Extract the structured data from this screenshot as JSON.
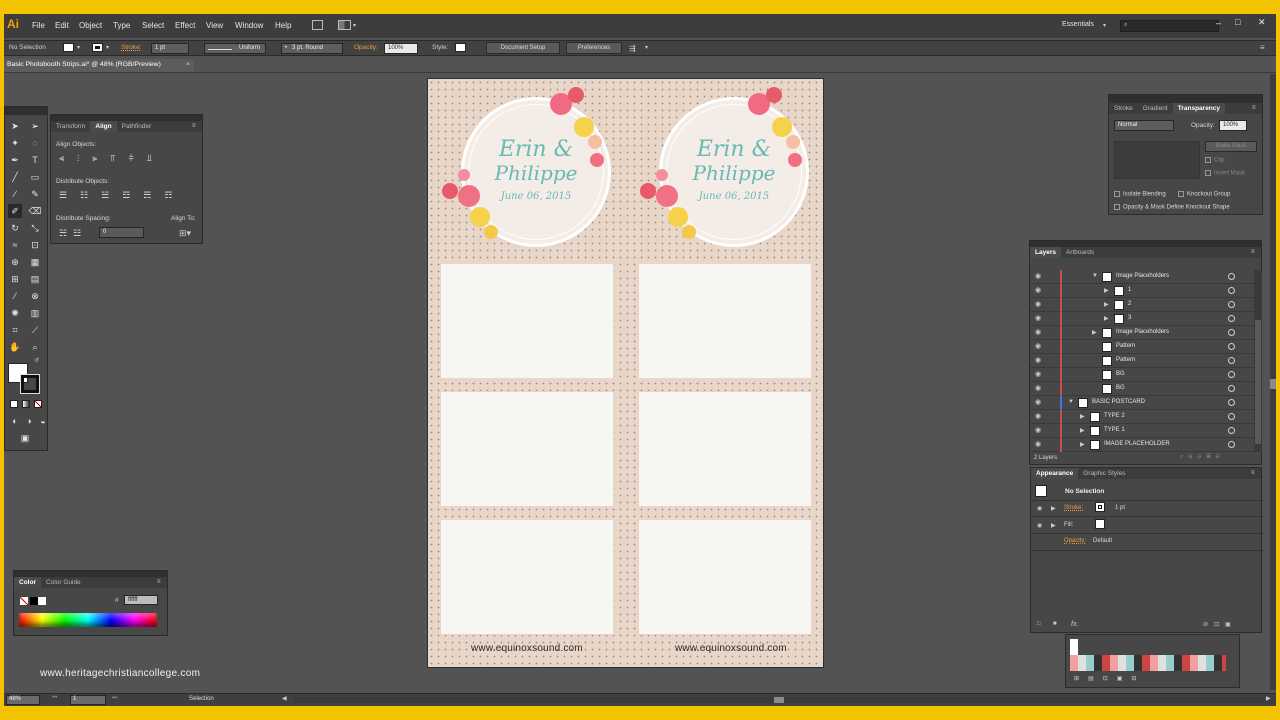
{
  "app": {
    "logo": "Ai",
    "menu": [
      "File",
      "Edit",
      "Object",
      "Type",
      "Select",
      "Effect",
      "View",
      "Window",
      "Help"
    ],
    "workspace": "Essentials",
    "search_placeholder": "",
    "win_controls": {
      "minimize": "–",
      "maximize": "□",
      "close": "✕"
    }
  },
  "control_bar": {
    "selection_label": "No Selection",
    "stroke_label": "Stroke:",
    "stroke_value": "1 pt",
    "profile_value": "Uniform",
    "brush_value": "3 pt. Round",
    "opacity_label": "Opacity:",
    "opacity_value": "100%",
    "style_label": "Style:",
    "document_setup": "Document Setup",
    "preferences": "Preferences"
  },
  "document_tab": {
    "title": "Basic Photobooth Strips.ai* @ 48% (RGB/Preview)",
    "close": "×"
  },
  "align_panel": {
    "tabs": [
      "Transform",
      "Align",
      "Pathfinder"
    ],
    "active_tab": "Align",
    "align_objects": "Align Objects:",
    "distribute_objects": "Distribute Objects:",
    "distribute_spacing": "Distribute Spacing:",
    "align_to": "Align To:",
    "spacing_value": "0"
  },
  "transparency_panel": {
    "tabs": [
      "Stroke",
      "Gradient",
      "Transparency"
    ],
    "active_tab": "Transparency",
    "blend_mode": "Normal",
    "opacity_label": "Opacity:",
    "opacity_value": "100%",
    "make_mask": "Make Mask",
    "clip": "Clip",
    "invert_mask": "Invert Mask",
    "isolate_blending": "Isolate Blending",
    "knockout_group": "Knockout Group",
    "opacity_mask": "Opacity & Mask Define Knockout Shape"
  },
  "layers_panel": {
    "tabs": [
      "Layers",
      "Artboards"
    ],
    "active_tab": "Layers",
    "rows": [
      {
        "name": "Image Placeholders",
        "indent": 2,
        "expand": "open"
      },
      {
        "name": "1",
        "indent": 3,
        "expand": "closed"
      },
      {
        "name": "2",
        "indent": 3,
        "expand": "closed"
      },
      {
        "name": "3",
        "indent": 3,
        "expand": "closed"
      },
      {
        "name": "Image Placeholders",
        "indent": 2,
        "expand": "closed"
      },
      {
        "name": "Pattern",
        "indent": 2,
        "expand": "none"
      },
      {
        "name": "Pattern",
        "indent": 2,
        "expand": "none"
      },
      {
        "name": "BG",
        "indent": 2,
        "expand": "none"
      },
      {
        "name": "BG",
        "indent": 2,
        "expand": "none"
      },
      {
        "name": "BASIC POSTCARD",
        "indent": 0,
        "expand": "open"
      },
      {
        "name": "TYPE 2",
        "indent": 1,
        "expand": "closed"
      },
      {
        "name": "TYPE 1",
        "indent": 1,
        "expand": "closed"
      },
      {
        "name": "IMAGE PLACEHOLDER",
        "indent": 1,
        "expand": "closed"
      }
    ],
    "footer": "2 Layers"
  },
  "appearance_panel": {
    "tabs": [
      "Appearance",
      "Graphic Styles"
    ],
    "active_tab": "Appearance",
    "selection": "No Selection",
    "stroke_label": "Stroke:",
    "stroke_value": "1 pt",
    "fill_label": "Fill:",
    "opacity_label": "Opacity:",
    "opacity_value": "Default",
    "fx": "fx."
  },
  "color_panel": {
    "tabs": [
      "Color",
      "Color Guide"
    ],
    "active_tab": "Color",
    "hex_label": "#",
    "hex_value": "ffffff"
  },
  "artboard": {
    "bride_groom": [
      "Erin &",
      "Philippe"
    ],
    "date": "June 06, 2015",
    "url": "www.equinoxsound.com"
  },
  "status_bar": {
    "zoom": "48%",
    "artboard_num": "1",
    "tool": "Selection"
  },
  "watermark": "www.heritagechristiancollege.com",
  "colors": {
    "accent_orange": "#f0a000",
    "teal_script": "#67b9b4",
    "artboard_bg": "#e8d6c8",
    "frame_yellow": "#f2c400"
  }
}
